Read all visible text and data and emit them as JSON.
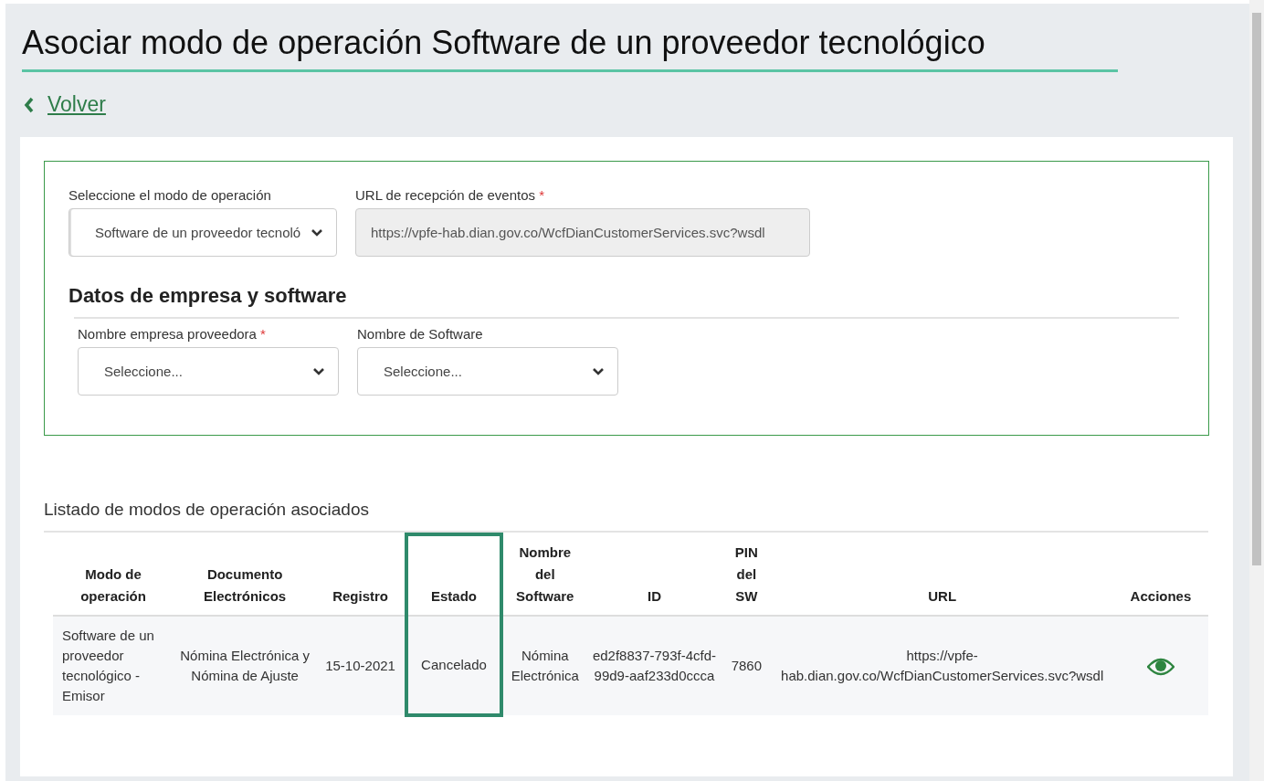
{
  "page": {
    "title": "Asociar modo de operación Software de un proveedor tecnológico",
    "back_link": "Volver"
  },
  "operation_form": {
    "mode": {
      "label": "Seleccione el modo de operación",
      "value": "Software de un proveedor tecnoló"
    },
    "events_url": {
      "label": "URL de recepción de eventos",
      "required_mark": "*",
      "value": "https://vpfe-hab.dian.gov.co/WcfDianCustomerServices.svc?wsdl",
      "disabled": true
    },
    "section_title": "Datos de empresa y software",
    "fields": [
      {
        "label": "Nombre empresa proveedora",
        "required_mark": "*",
        "placeholder": "Seleccione..."
      },
      {
        "label": "Nombre de Software",
        "placeholder": "Seleccione..."
      }
    ]
  },
  "table": {
    "title": "Listado de modos de operación asociados",
    "columns": [
      {
        "label": "Modo de operación",
        "highlighted": false
      },
      {
        "label": "Documento Electrónicos",
        "highlighted": false
      },
      {
        "label": "Registro",
        "highlighted": false
      },
      {
        "label": "Estado",
        "highlighted": true
      },
      {
        "label": "Nombre del Software",
        "highlighted": false
      },
      {
        "label": "ID",
        "highlighted": false
      },
      {
        "label": "PIN del SW",
        "highlighted": false
      },
      {
        "label": "URL",
        "highlighted": false
      },
      {
        "label": "Acciones",
        "highlighted": false
      }
    ],
    "rows": [
      {
        "cells": [
          "Software de un proveedor tecnológico - Emisor",
          "Nómina Electrónica y Nómina de Ajuste",
          "15-10-2021",
          "Cancelado",
          "Nómina Electrónica",
          "ed2f8837-793f-4cfd-99d9-aaf233d0ccca",
          "7860",
          "https://vpfe-hab.dian.gov.co/WcfDianCustomerServices.svc?wsdl"
        ]
      }
    ]
  }
}
